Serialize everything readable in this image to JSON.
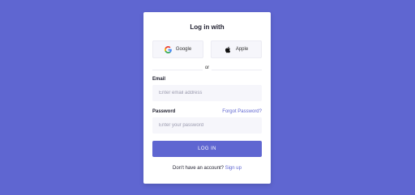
{
  "card": {
    "title": "Log in with",
    "google_label": "Google",
    "apple_label": "Apple",
    "divider_text": "or",
    "email_label": "Email",
    "email_placeholder": "Enter email address",
    "email_value": "",
    "password_label": "Password",
    "forgot_label": "Forgot Password?",
    "password_placeholder": "Enter your password",
    "password_value": "",
    "login_label": "LOG IN",
    "signup_prompt": "Don't have an account?",
    "signup_link": "Sign up"
  },
  "icons": {
    "google": "google-icon",
    "apple": "apple-icon"
  },
  "colors": {
    "background": "#5f66d1",
    "accent": "#5f66d1",
    "card": "#ffffff"
  }
}
